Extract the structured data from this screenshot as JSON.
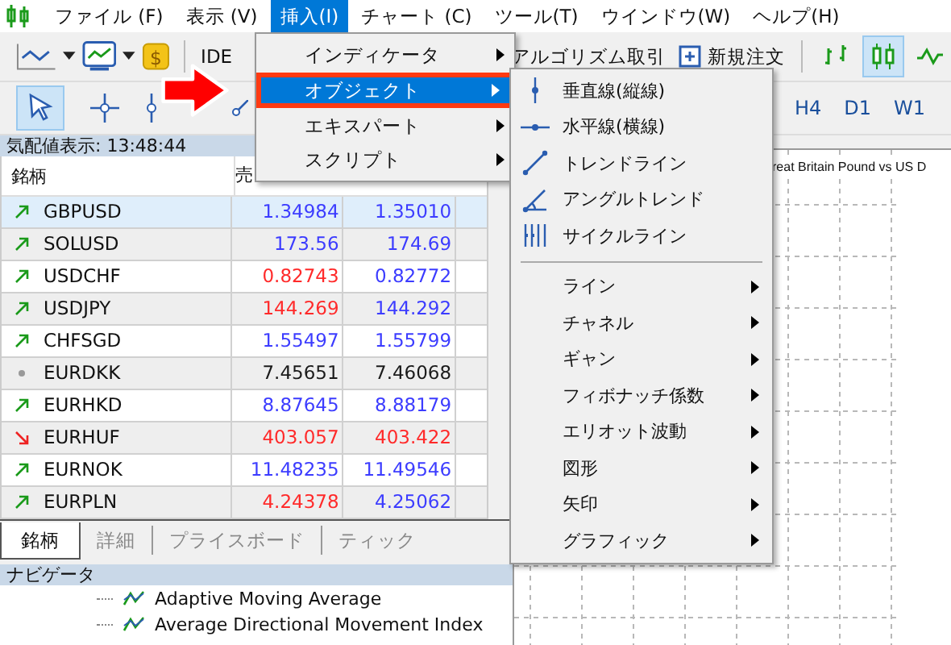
{
  "coin_symbol": "$",
  "menu_bar": [
    {
      "label": "ファイル (F)",
      "selected": false
    },
    {
      "label": "表示 (V)",
      "selected": false
    },
    {
      "label": "挿入(I)",
      "selected": true
    },
    {
      "label": "チャート (C)",
      "selected": false
    },
    {
      "label": "ツール(T)",
      "selected": false
    },
    {
      "label": "ウインドウ(W)",
      "selected": false
    },
    {
      "label": "ヘルプ(H)",
      "selected": false
    }
  ],
  "toolbar": {
    "ide_label": "IDE",
    "algo_trading": "アルゴリズム取引",
    "new_order": "新規注文",
    "chart_types": [
      {
        "kind": "bars",
        "selected": false
      },
      {
        "kind": "candles",
        "selected": true
      },
      {
        "kind": "line",
        "selected": false
      }
    ]
  },
  "drawing_toolbar": {
    "tools": [
      {
        "kind": "cursor",
        "selected": true
      },
      {
        "kind": "crosshair",
        "selected": false
      },
      {
        "kind": "vline",
        "selected": false
      },
      {
        "kind": "trendline",
        "selected": false
      }
    ],
    "timeframes": [
      "H4",
      "D1",
      "W1"
    ]
  },
  "market_watch": {
    "title": "気配値表示: 13:48:44",
    "columns": [
      "銘柄",
      "売"
    ],
    "rows": [
      {
        "symbol": "GBPUSD",
        "kind": "up",
        "selected": true,
        "bid": {
          "text": "1.34984",
          "color": "#3c3cff"
        },
        "ask": {
          "text": "1.35010",
          "color": "#3c3cff"
        }
      },
      {
        "symbol": "SOLUSD",
        "kind": "up",
        "selected": false,
        "bid": {
          "text": "173.56",
          "color": "#3c3cff"
        },
        "ask": {
          "text": "174.69",
          "color": "#3c3cff"
        }
      },
      {
        "symbol": "USDCHF",
        "kind": "up",
        "selected": false,
        "bid": {
          "text": "0.82743",
          "color": "#ff2a2a"
        },
        "ask": {
          "text": "0.82772",
          "color": "#3c3cff"
        }
      },
      {
        "symbol": "USDJPY",
        "kind": "up",
        "selected": false,
        "bid": {
          "text": "144.269",
          "color": "#ff2a2a"
        },
        "ask": {
          "text": "144.292",
          "color": "#3c3cff"
        }
      },
      {
        "symbol": "CHFSGD",
        "kind": "up",
        "selected": false,
        "bid": {
          "text": "1.55497",
          "color": "#3c3cff"
        },
        "ask": {
          "text": "1.55799",
          "color": "#3c3cff"
        }
      },
      {
        "symbol": "EURDKK",
        "kind": "flat",
        "selected": false,
        "bid": {
          "text": "7.45651",
          "color": "#1a1a1a"
        },
        "ask": {
          "text": "7.46068",
          "color": "#1a1a1a"
        }
      },
      {
        "symbol": "EURHKD",
        "kind": "up",
        "selected": false,
        "bid": {
          "text": "8.87645",
          "color": "#3c3cff"
        },
        "ask": {
          "text": "8.88179",
          "color": "#3c3cff"
        }
      },
      {
        "symbol": "EURHUF",
        "kind": "down",
        "selected": false,
        "bid": {
          "text": "403.057",
          "color": "#ff2a2a"
        },
        "ask": {
          "text": "403.422",
          "color": "#ff2a2a"
        }
      },
      {
        "symbol": "EURNOK",
        "kind": "up",
        "selected": false,
        "bid": {
          "text": "11.48235",
          "color": "#3c3cff"
        },
        "ask": {
          "text": "11.49546",
          "color": "#3c3cff"
        }
      },
      {
        "symbol": "EURPLN",
        "kind": "up",
        "selected": false,
        "bid": {
          "text": "4.24378",
          "color": "#ff2a2a"
        },
        "ask": {
          "text": "4.25062",
          "color": "#3c3cff"
        }
      }
    ],
    "tabs": [
      {
        "label": "銘柄",
        "selected": true
      },
      {
        "label": "詳細",
        "selected": false
      },
      {
        "label": "プライスボード",
        "selected": false
      },
      {
        "label": "ティック",
        "selected": false
      }
    ]
  },
  "navigator": {
    "title": "ナビゲータ",
    "items": [
      "Adaptive Moving Average",
      "Average Directional Movement Index"
    ]
  },
  "chart": {
    "title": "reat Britain Pound vs US D"
  },
  "insert_menu": {
    "items": [
      {
        "label": "インディケータ",
        "selected": false
      },
      {
        "label": "オブジェクト",
        "selected": true
      },
      {
        "label": "エキスパート",
        "selected": false
      },
      {
        "label": "スクリプト",
        "selected": false
      }
    ]
  },
  "object_submenu": {
    "items": [
      {
        "kind": "vline",
        "label": "垂直線(縦線)"
      },
      {
        "kind": "hline",
        "label": "水平線(横線)"
      },
      {
        "kind": "trendline",
        "label": "トレンドライン"
      },
      {
        "kind": "angle",
        "label": "アングルトレンド"
      },
      {
        "kind": "cycle",
        "label": "サイクルライン"
      },
      {
        "kind": "group",
        "label": "ライン"
      },
      {
        "kind": "group",
        "label": "チャネル"
      },
      {
        "kind": "group",
        "label": "ギャン"
      },
      {
        "kind": "group",
        "label": "フィボナッチ係数"
      },
      {
        "kind": "group",
        "label": "エリオット波動"
      },
      {
        "kind": "group",
        "label": "図形"
      },
      {
        "kind": "group",
        "label": "矢印"
      },
      {
        "kind": "group",
        "label": "グラフィック"
      }
    ]
  }
}
